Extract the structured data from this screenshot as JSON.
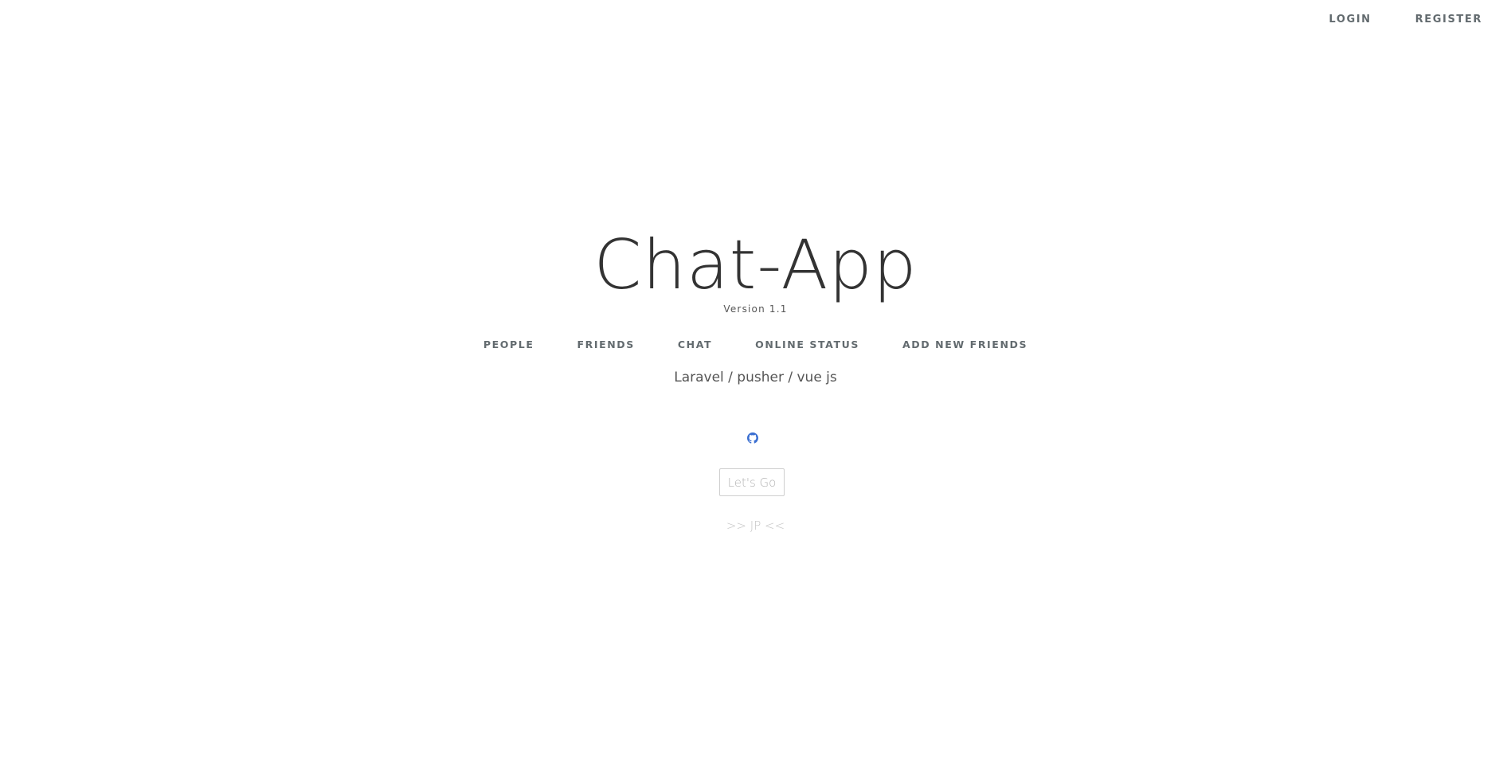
{
  "header": {
    "login_label": "LOGIN",
    "register_label": "REGISTER"
  },
  "hero": {
    "title": "Chat-App",
    "version": "Version 1.1"
  },
  "nav": {
    "items": [
      {
        "label": "PEOPLE"
      },
      {
        "label": "FRIENDS"
      },
      {
        "label": "CHAT"
      },
      {
        "label": "ONLINE STATUS"
      },
      {
        "label": "ADD NEW FRIENDS"
      }
    ]
  },
  "stack_text": "Laravel / pusher / vue js",
  "github_icon": "github-icon",
  "cta": {
    "label": "Let's Go"
  },
  "signature": ">> JP <<",
  "colors": {
    "text_dark": "#333333",
    "text_muted": "#636b6f",
    "github_blue": "#3b6fd1",
    "button_border": "#cfcfcf",
    "signature": "#c4c4c4"
  }
}
